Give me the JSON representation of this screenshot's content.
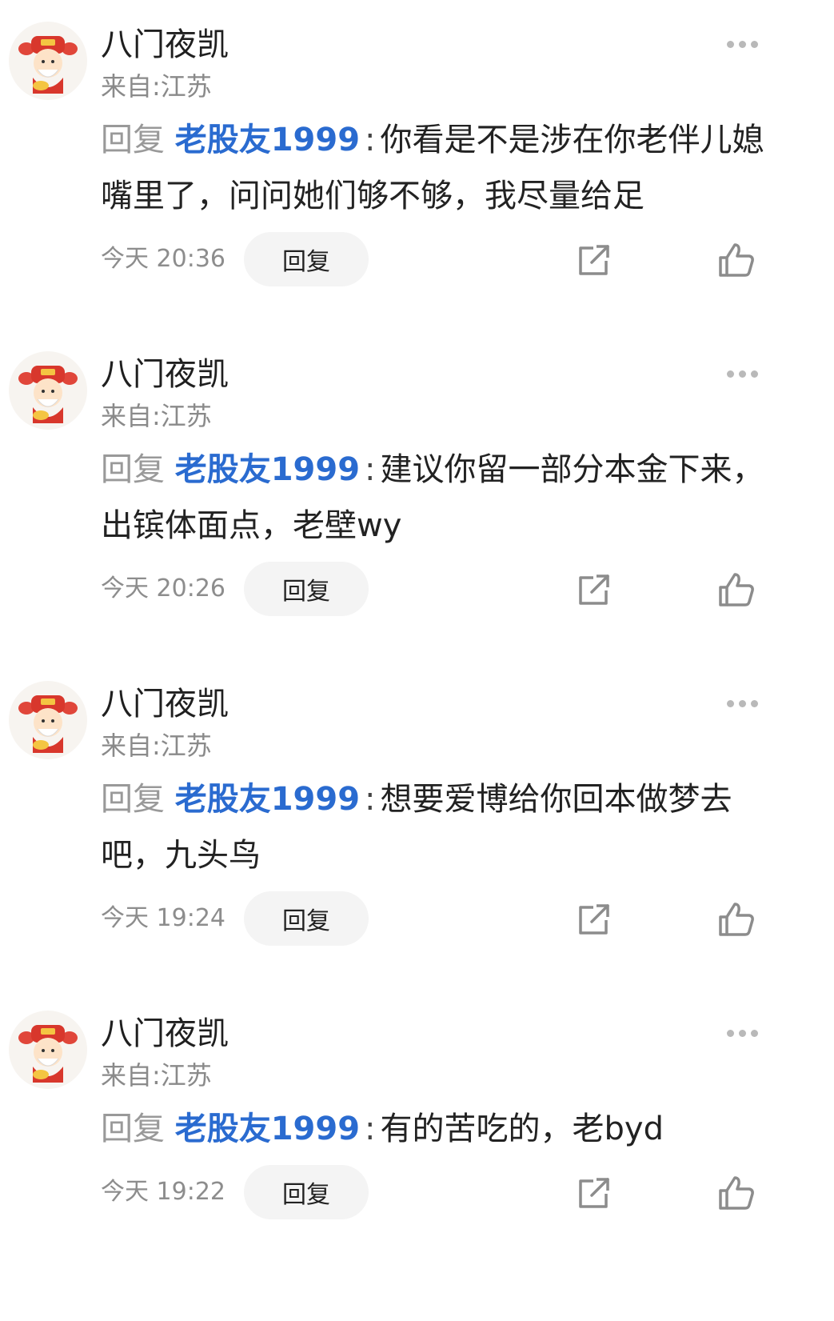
{
  "comments": [
    {
      "username": "八门夜凯",
      "location": "来自:江苏",
      "reply_prefix": "回复",
      "reply_target": "老股友1999",
      "colon": ":",
      "text": "你看是不是涉在你老伴儿媳嘴里了，问问她们够不够，我尽量给足",
      "time": "今天 20:36",
      "reply_button_label": "回复"
    },
    {
      "username": "八门夜凯",
      "location": "来自:江苏",
      "reply_prefix": "回复",
      "reply_target": "老股友1999",
      "colon": ":",
      "text": "建议你留一部分本金下来，出镔体面点，老壁wy",
      "time": "今天 20:26",
      "reply_button_label": "回复"
    },
    {
      "username": "八门夜凯",
      "location": "来自:江苏",
      "reply_prefix": "回复",
      "reply_target": "老股友1999",
      "colon": ":",
      "text": "想要爱博给你回本做梦去吧，九头鸟",
      "time": "今天 19:24",
      "reply_button_label": "回复"
    },
    {
      "username": "八门夜凯",
      "location": "来自:江苏",
      "reply_prefix": "回复",
      "reply_target": "老股友1999",
      "colon": ":",
      "text": "有的苦吃的，老byd",
      "time": "今天 19:22",
      "reply_button_label": "回复"
    }
  ],
  "icons": {
    "avatar": "cartoon-god-of-wealth-avatar",
    "more": "more-dots-icon",
    "share": "share-external-icon",
    "like": "thumbs-up-icon"
  },
  "colors": {
    "reply_target": "#2a6bd0",
    "secondary_text": "#8a8a8a",
    "button_bg": "#f4f4f4"
  }
}
